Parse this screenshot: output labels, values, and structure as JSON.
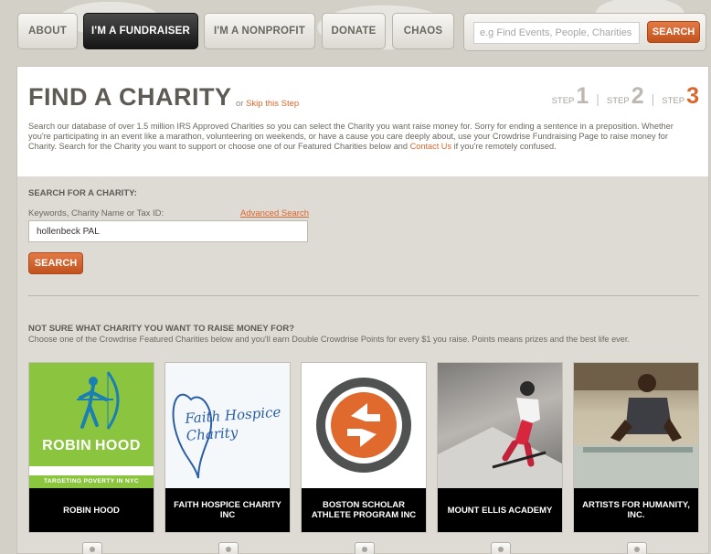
{
  "nav": {
    "items": [
      "ABOUT",
      "I'M A FUNDRAISER",
      "I'M A NONPROFIT",
      "DONATE",
      "CHAOS"
    ],
    "active_index": 1,
    "search_placeholder": "e.g Find Events, People, Charities",
    "search_button": "SEARCH"
  },
  "header": {
    "title": "FIND A CHARITY",
    "skip_prefix": "or",
    "skip_link": "Skip this Step",
    "steps": [
      {
        "label": "STEP",
        "num": "1"
      },
      {
        "label": "STEP",
        "num": "2"
      },
      {
        "label": "STEP",
        "num": "3"
      }
    ],
    "current_step": 3,
    "intro_text": "Search our database of over 1.5 million IRS Approved Charities so you can select the Charity you want raise money for. Sorry for ending a sentence in a preposition. Whether you're participating in an event like a marathon, volunteering on weekends, or have a cause you care deeply about, use your Crowdrise Fundraising Page to raise money for Charity. Search for the Charity you want to support or choose one of our Featured Charities below and",
    "contact_link": "Contact Us",
    "intro_suffix": "if you're remotely confused."
  },
  "search_section": {
    "title": "SEARCH FOR A CHARITY:",
    "field_label": "Keywords, Charity Name or Tax ID:",
    "advanced_link": "Advanced Search",
    "input_value": "hollenbeck PAL",
    "button": "SEARCH"
  },
  "featured": {
    "title": "NOT SURE WHAT CHARITY YOU WANT TO RAISE MONEY FOR?",
    "subtitle": "Choose one of the Crowdrise Featured Charities below and you'll earn Double Crowdrise Points for every $1 you raise. Points means prizes and the best life ever.",
    "charities": [
      {
        "name": "ROBIN HOOD",
        "logo_text": "ROBIN HOOD",
        "tagline": "TARGETING POVERTY IN NYC"
      },
      {
        "name": "FAITH HOSPICE CHARITY INC",
        "logo_text": "Faith Hospice Charity"
      },
      {
        "name": "BOSTON SCHOLAR ATHLETE PROGRAM INC"
      },
      {
        "name": "MOUNT ELLIS ACADEMY"
      },
      {
        "name": "ARTISTS FOR HUMANITY, INC."
      }
    ]
  },
  "colors": {
    "accent": "#d8662d",
    "robin_green": "#8bc53f",
    "active_nav": "#1c1c1c"
  }
}
